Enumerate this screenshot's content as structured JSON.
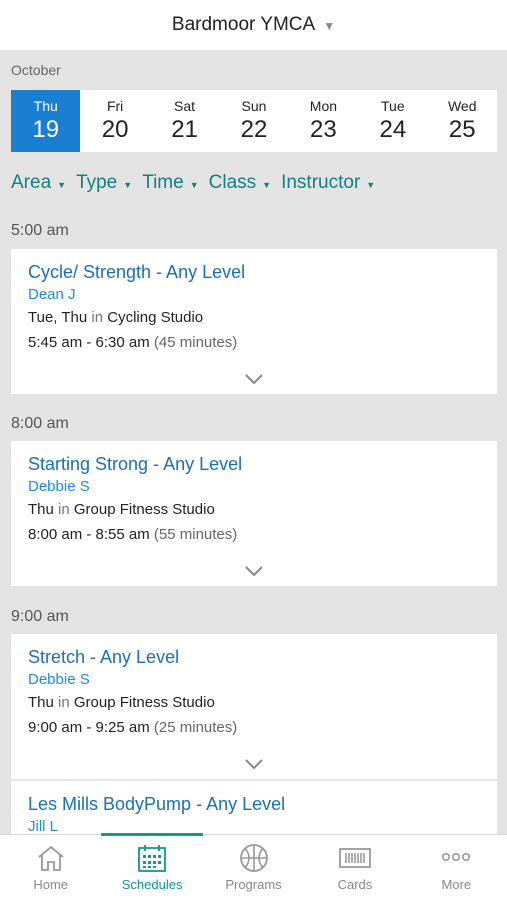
{
  "header": {
    "title": "Bardmoor YMCA"
  },
  "month": "October",
  "days": [
    {
      "dow": "Thu",
      "num": "19",
      "active": true
    },
    {
      "dow": "Fri",
      "num": "20"
    },
    {
      "dow": "Sat",
      "num": "21"
    },
    {
      "dow": "Sun",
      "num": "22"
    },
    {
      "dow": "Mon",
      "num": "23"
    },
    {
      "dow": "Tue",
      "num": "24"
    },
    {
      "dow": "Wed",
      "num": "25"
    }
  ],
  "filters": [
    "Area",
    "Type",
    "Time",
    "Class",
    "Instructor"
  ],
  "sections": [
    {
      "time": "5:00 am",
      "classes": [
        {
          "name": "Cycle/ Strength - Any Level",
          "instructor": "Dean J",
          "days": "Tue, Thu",
          "in_word": "in",
          "location": "Cycling Studio",
          "hours": "5:45 am - 6:30 am",
          "duration": "(45 minutes)"
        }
      ]
    },
    {
      "time": "8:00 am",
      "classes": [
        {
          "name": "Starting Strong - Any Level",
          "instructor": "Debbie S",
          "days": "Thu",
          "in_word": "in",
          "location": "Group Fitness Studio",
          "hours": "8:00 am - 8:55 am",
          "duration": "(55 minutes)"
        }
      ]
    },
    {
      "time": "9:00 am",
      "classes": [
        {
          "name": "Stretch - Any Level",
          "instructor": "Debbie S",
          "days": "Thu",
          "in_word": "in",
          "location": "Group Fitness Studio",
          "hours": "9:00 am - 9:25 am",
          "duration": "(25 minutes)"
        },
        {
          "name": "Les Mills BodyPump - Any Level",
          "instructor": "Jill L"
        }
      ]
    }
  ],
  "tabs": [
    {
      "label": "Home",
      "icon": "home-icon"
    },
    {
      "label": "Schedules",
      "icon": "calendar-icon",
      "active": true
    },
    {
      "label": "Programs",
      "icon": "basketball-icon"
    },
    {
      "label": "Cards",
      "icon": "barcode-card-icon"
    },
    {
      "label": "More",
      "icon": "more-dots-icon"
    }
  ],
  "colors": {
    "accent_blue": "#1a7fd1",
    "teal": "#13988b",
    "link": "#1a6fb5",
    "filter_teal": "#12807f"
  }
}
